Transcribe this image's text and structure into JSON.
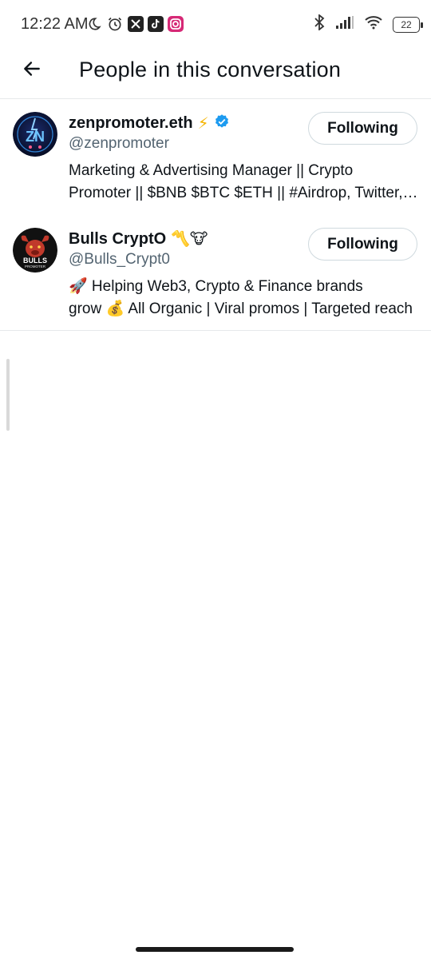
{
  "status_bar": {
    "time": "12:22 AM",
    "battery": "22",
    "left_icons": [
      "moon-icon",
      "alarm-icon",
      "x-app-icon",
      "tiktok-icon",
      "instagram-icon"
    ],
    "right_icons": [
      "bluetooth-icon",
      "signal-icon",
      "wifi-icon",
      "battery-icon"
    ]
  },
  "header": {
    "title": "People in this conversation",
    "back_icon": "back-arrow-icon"
  },
  "people": [
    {
      "name": "zenpromoter.eth",
      "name_emoji": "⚡",
      "verified": true,
      "handle": "@zenpromoter",
      "bio_line1": "Marketing & Advertising Manager || Crypto",
      "bio_line2": "Promoter || $BNB $BTC $ETH || #Airdrop, Twitter, Telegram",
      "button": "Following",
      "avatar_text": "ZN"
    },
    {
      "name": "Bulls CryptO",
      "name_emoji": "〽️🐮",
      "verified": false,
      "handle": "@Bulls_Crypt0",
      "bio_line1": "🚀 Helping Web3, Crypto & Finance brands",
      "bio_line2": "grow 💰 All Organic | Viral promos | Targeted reach",
      "button": "Following",
      "avatar_text": "BULLS",
      "avatar_subtext": "PROMOTER"
    }
  ],
  "colors": {
    "accent_verified": "#1d9bf0",
    "text_primary": "#0f1419",
    "text_secondary": "#536471",
    "border": "#cfd9de"
  }
}
